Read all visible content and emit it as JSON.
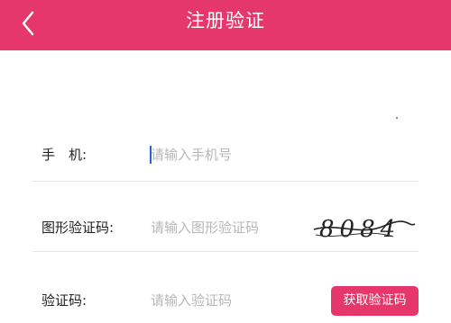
{
  "header": {
    "title": "注册验证",
    "back_icon": "chevron-left-icon"
  },
  "form": {
    "phone": {
      "label": "手　机:",
      "placeholder": "请输入手机号"
    },
    "image_code": {
      "label": "图形验证码:",
      "placeholder": "请输入图形验证码",
      "captcha_text": "8084"
    },
    "sms_code": {
      "label": "验证码:",
      "placeholder": "请输入验证码",
      "button_label": "获取验证码"
    }
  },
  "colors": {
    "accent": "#e5376b",
    "placeholder": "#b7b7b7",
    "label": "#222222",
    "cursor": "#2f5fd6"
  }
}
